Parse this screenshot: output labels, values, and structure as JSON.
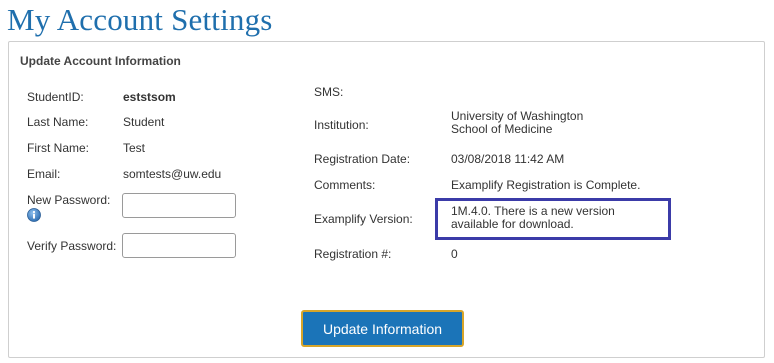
{
  "page": {
    "title": "My Account Settings"
  },
  "panel": {
    "heading": "Update Account Information"
  },
  "left": {
    "student_id_label": "StudentID:",
    "student_id_value": "eststsom",
    "last_name_label": "Last Name:",
    "last_name_value": "Student",
    "first_name_label": "First Name:",
    "first_name_value": "Test",
    "email_label": "Email:",
    "email_value": "somtests@uw.edu",
    "new_password_label": "New Password:",
    "new_password_value": "",
    "verify_password_label": "Verify Password:",
    "verify_password_value": ""
  },
  "right": {
    "sms_label": "SMS:",
    "sms_value": "",
    "institution_label": "Institution:",
    "institution_value": "University of Washington School of Medicine",
    "registration_date_label": "Registration Date:",
    "registration_date_value": "03/08/2018 11:42 AM",
    "comments_label": "Comments:",
    "comments_value": "Examplify Registration is Complete.",
    "examplify_version_label": "Examplify Version:",
    "examplify_version_value": "1M.4.0. There is a new version available for download.",
    "registration_number_label": "Registration #:",
    "registration_number_value": "0"
  },
  "actions": {
    "update_label": "Update Information"
  },
  "colors": {
    "title": "#1f6fad",
    "button_bg": "#1b74b8",
    "button_border": "#d7a52a",
    "highlight": "#3b3ba8",
    "info_icon": "#3f7fc0"
  },
  "icons": {
    "password_help": "info-icon"
  }
}
